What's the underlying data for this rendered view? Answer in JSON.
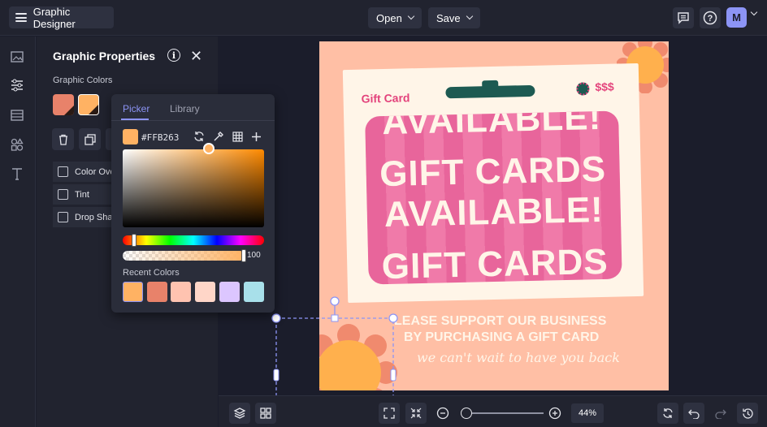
{
  "app": {
    "title": "Graphic Designer",
    "avatar_initial": "M"
  },
  "topbar": {
    "open_label": "Open",
    "save_label": "Save"
  },
  "panel": {
    "title": "Graphic Properties",
    "graphic_colors_label": "Graphic Colors",
    "swatches": [
      "#e8826a",
      "#ffb263"
    ],
    "options": [
      "Color Ove",
      "Tint",
      "Drop Sha"
    ]
  },
  "picker": {
    "tabs": [
      "Picker",
      "Library"
    ],
    "hex": "#FFB263",
    "alpha": "100",
    "recent_label": "Recent Colors",
    "recent_colors": [
      "#ffb263",
      "#e8826a",
      "#ffc3b0",
      "#ffd6c8",
      "#dcc6ff",
      "#a8e0ea"
    ]
  },
  "design": {
    "card_label": "Gift Card",
    "price_label": "$$$",
    "line1": "AVAILABLE!",
    "line2": "GIFT CARDS",
    "line3": "AVAILABLE!",
    "line4": "GIFT CARDS",
    "support1": "LEASE SUPPORT OUR BUSINESS",
    "support2": "BY PURCHASING A GIFT CARD",
    "script": "we can't wait to have you back"
  },
  "zoom": {
    "value": "44%",
    "level_fraction": 0.44
  }
}
